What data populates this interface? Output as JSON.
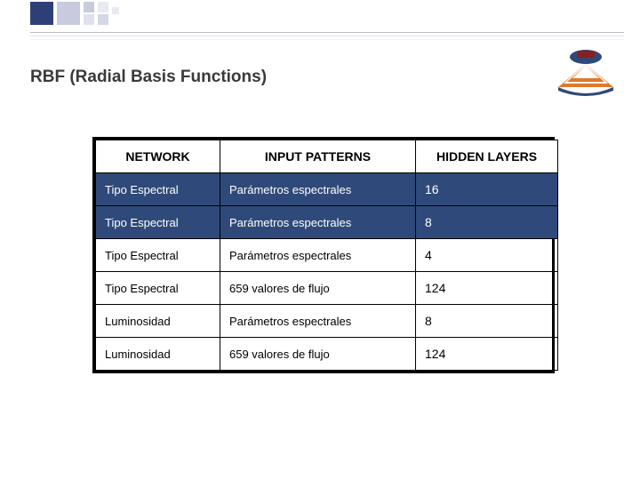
{
  "title": "RBF (Radial Basis Functions)",
  "table": {
    "headers": {
      "network": "NETWORK",
      "input": "INPUT PATTERNS",
      "hidden": "HIDDEN LAYERS"
    },
    "rows": [
      {
        "network": "Tipo Espectral",
        "input": "Parámetros espectrales",
        "hidden": "16",
        "highlight": true
      },
      {
        "network": "Tipo Espectral",
        "input": "Parámetros espectrales",
        "hidden": "8",
        "highlight": true
      },
      {
        "network": "Tipo Espectral",
        "input": "Parámetros espectrales",
        "hidden": "4",
        "highlight": false
      },
      {
        "network": "Tipo Espectral",
        "input": "659 valores de flujo",
        "hidden": "124",
        "highlight": false
      },
      {
        "network": "Luminosidad",
        "input": "Parámetros espectrales",
        "hidden": "8",
        "highlight": false
      },
      {
        "network": "Luminosidad",
        "input": "659 valores de flujo",
        "hidden": "124",
        "highlight": false
      }
    ]
  }
}
